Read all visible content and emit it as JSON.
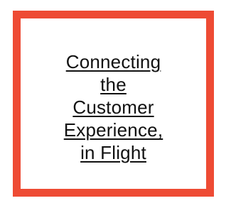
{
  "card": {
    "border_color": "#ee4b34",
    "background": "#ffffff",
    "title_lines": [
      "Connecting",
      "the",
      "Customer",
      "Experience,",
      "in Flight"
    ]
  }
}
